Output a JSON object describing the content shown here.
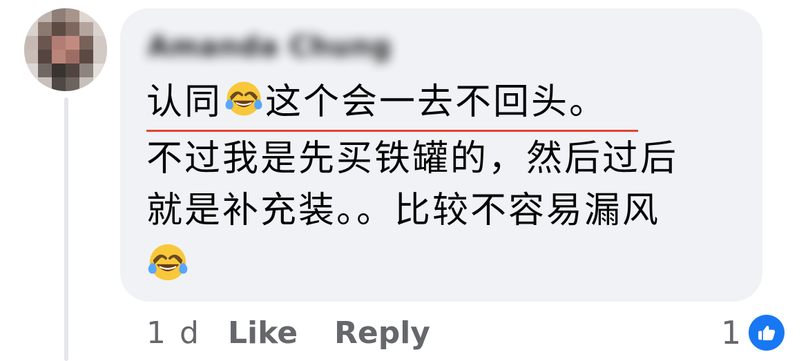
{
  "comment": {
    "author_name": "Amanda Chung",
    "line1_prefix": "认同",
    "emoji_name": "face-with-tears-of-joy",
    "line1_suffix": "这个会一去不回头。",
    "line2": "不过我是先买铁罐的，然后过后",
    "line3": "就是补充装。。比较不容易漏风",
    "highlight_color": "#e3422f"
  },
  "meta": {
    "time": "1 d",
    "like_label": "Like",
    "reply_label": "Reply"
  },
  "reactions": {
    "count": "1",
    "type": "like",
    "badge_icon": "thumbs-up-icon",
    "badge_color": "#1877f2"
  },
  "colors": {
    "bubble": "#f0f2f5",
    "text": "#050505",
    "secondary_text": "#65676b",
    "thread_line": "#e4e6eb"
  }
}
